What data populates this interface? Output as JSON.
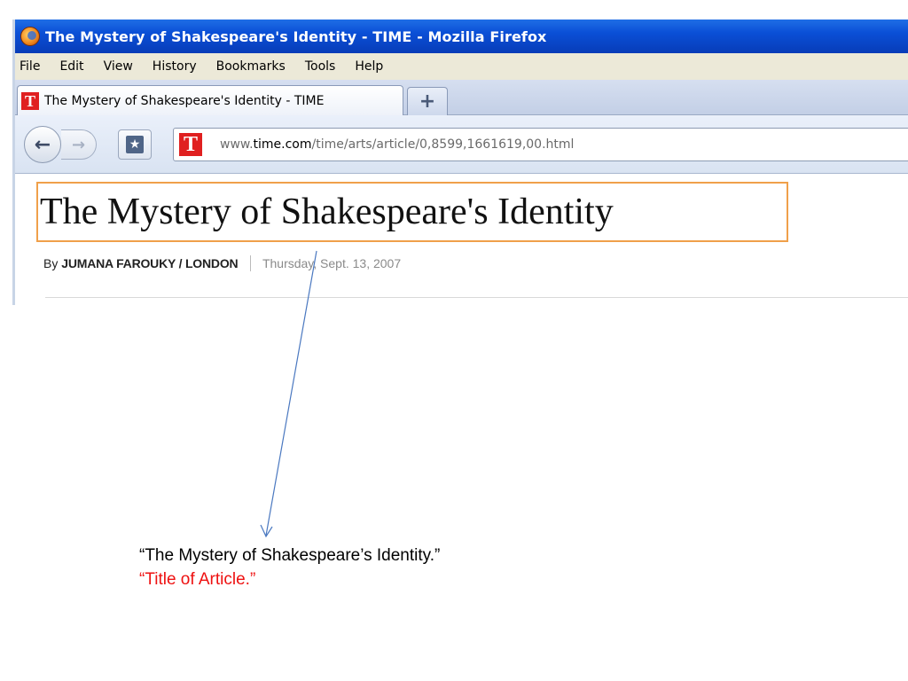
{
  "window": {
    "title": "The Mystery of Shakespeare's Identity - TIME - Mozilla Firefox",
    "icon": "firefox-icon"
  },
  "menubar": {
    "items": [
      "File",
      "Edit",
      "View",
      "History",
      "Bookmarks",
      "Tools",
      "Help"
    ]
  },
  "tabs": [
    {
      "label": "The Mystery of Shakespeare's Identity - TIME",
      "favicon": "T"
    }
  ],
  "new_tab_label": "+",
  "navigation": {
    "url_prefix": "www.",
    "url_domain": "time.com",
    "url_path": "/time/arts/article/0,8599,1661619,00.html",
    "site_favicon": "T"
  },
  "article": {
    "headline": "The Mystery of Shakespeare's Identity",
    "byline_prefix": "By",
    "author": "JUMANA FAROUKY / LONDON",
    "date": "Thursday, Sept. 13, 2007"
  },
  "annotation": {
    "quote": "“The Mystery of Shakespeare’s Identity.”",
    "label": "“Title of Article.”",
    "highlight_color": "#f0a04a",
    "arrow_color": "#4a78c0",
    "label_color": "#ee1111"
  }
}
